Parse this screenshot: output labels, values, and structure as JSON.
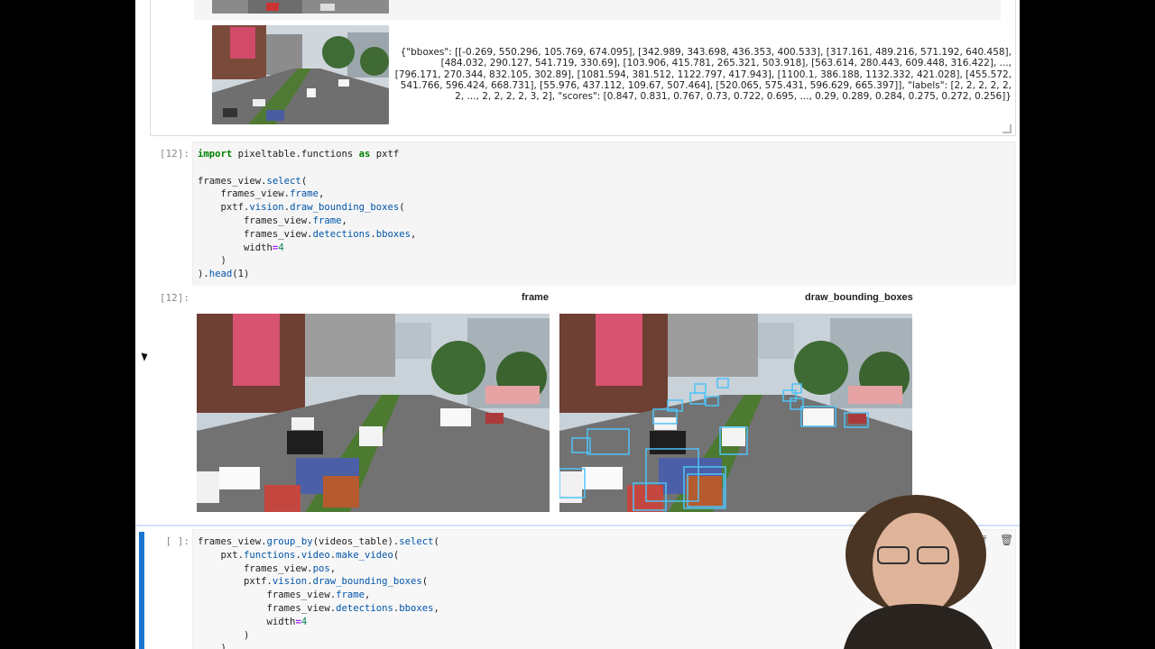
{
  "previous_output": {
    "bboxes_text": "{\"bboxes\": [[-0.269, 550.296, 105.769, 674.095], [342.989, 343.698, 436.353, 400.533], [317.161, 489.216, 571.192, 640.458], [484.032, 290.127, 541.719, 330.69], [103.906, 415.781, 265.321, 503.918], [563.614, 280.443, 609.448, 316.422], ..., [796.171, 270.344, 832.105, 302.89], [1081.594, 381.512, 1122.797, 417.943], [1100.1, 386.188, 1132.332, 421.028], [455.572, 541.766, 596.424, 668.731], [55.976, 437.112, 109.67, 507.464], [520.065, 575.431, 596.629, 665.397]], \"labels\": [2, 2, 2, 2, 2, 2, ..., 2, 2, 2, 2, 3, 2], \"scores\": [0.847, 0.831, 0.767, 0.73, 0.722, 0.695, ..., 0.29, 0.289, 0.284, 0.275, 0.272, 0.256]}"
  },
  "cell12": {
    "in_prompt": "[12]:",
    "out_prompt": "[12]:",
    "code": {
      "l1_kw": "import",
      "l1_mod": " pixeltable.functions ",
      "l1_as": "as",
      "l1_alias": " pxtf",
      "l3a": "frames_view.",
      "l3b": "select",
      "l3c": "(",
      "l4a": "    frames_view.",
      "l4b": "frame",
      "l4c": ",",
      "l5a": "    pxtf.",
      "l5b": "vision",
      "l5c": ".",
      "l5d": "draw_bounding_boxes",
      "l5e": "(",
      "l6a": "        frames_view.",
      "l6b": "frame",
      "l6c": ",",
      "l7a": "        frames_view.",
      "l7b": "detections",
      "l7c": ".",
      "l7d": "bboxes",
      "l7e": ",",
      "l8a": "        width",
      "l8b": "=",
      "l8c": "4",
      "l9": "    )",
      "l10a": ").",
      "l10b": "head",
      "l10c": "(1)"
    },
    "result": {
      "col1": "frame",
      "col2": "draw_bounding_boxes"
    }
  },
  "cell_next": {
    "prompt": "[ ]:",
    "code": {
      "l1a": "frames_view.",
      "l1b": "group_by",
      "l1c": "(videos_table).",
      "l1d": "select",
      "l1e": "(",
      "l2a": "    pxt.",
      "l2b": "functions",
      "l2c": ".",
      "l2d": "video",
      "l2e": ".",
      "l2f": "make_video",
      "l2g": "(",
      "l3a": "        frames_view.",
      "l3b": "pos",
      "l3c": ",",
      "l4a": "        pxtf.",
      "l4b": "vision",
      "l4c": ".",
      "l4d": "draw_bounding_boxes",
      "l4e": "(",
      "l5a": "            frames_view.",
      "l5b": "frame",
      "l5c": ",",
      "l6a": "            frames_view.",
      "l6b": "detections",
      "l6c": ".",
      "l6d": "bboxes",
      "l6e": ",",
      "l7a": "            width",
      "l7b": "=",
      "l7c": "4",
      "l8": "        )",
      "l9": "    )"
    }
  },
  "colors": {
    "active_cell": "#1976d2",
    "bbox": "#4fc3f7"
  }
}
